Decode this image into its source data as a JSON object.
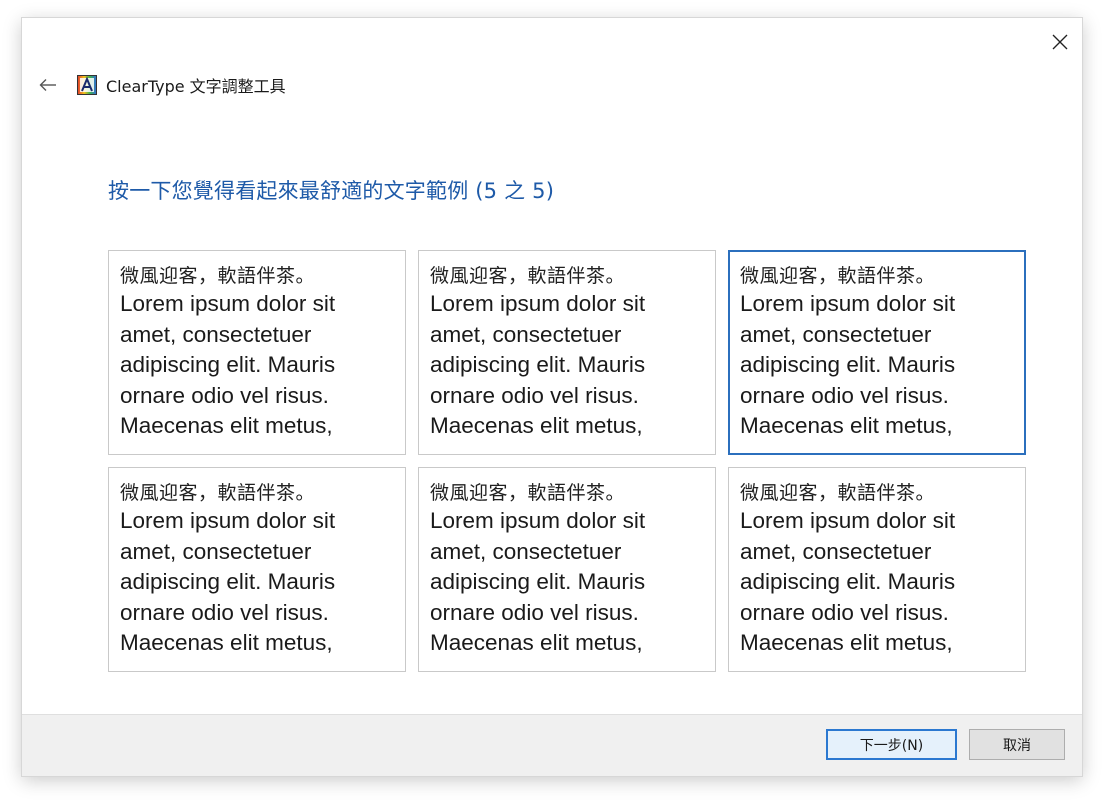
{
  "window": {
    "close_icon": "close-icon",
    "back_icon": "arrow-left-icon",
    "app_icon": "cleartype-icon",
    "app_title": "ClearType 文字調整工具"
  },
  "heading": "按一下您覺得看起來最舒適的文字範例 (5 之 5)",
  "samples": [
    {
      "cjk": "微風迎客，軟語伴茶。",
      "latin": "Lorem ipsum dolor sit amet, consectetuer adipiscing elit. Mauris ornare odio vel risus. Maecenas elit metus,",
      "selected": false
    },
    {
      "cjk": "微風迎客，軟語伴茶。",
      "latin": "Lorem ipsum dolor sit amet, consectetuer adipiscing elit. Mauris ornare odio vel risus. Maecenas elit metus,",
      "selected": false
    },
    {
      "cjk": "微風迎客，軟語伴茶。",
      "latin": "Lorem ipsum dolor sit amet, consectetuer adipiscing elit. Mauris ornare odio vel risus. Maecenas elit metus,",
      "selected": true
    },
    {
      "cjk": "微風迎客，軟語伴茶。",
      "latin": "Lorem ipsum dolor sit amet, consectetuer adipiscing elit. Mauris ornare odio vel risus. Maecenas elit metus,",
      "selected": false
    },
    {
      "cjk": "微風迎客，軟語伴茶。",
      "latin": "Lorem ipsum dolor sit amet, consectetuer adipiscing elit. Mauris ornare odio vel risus. Maecenas elit metus,",
      "selected": false
    },
    {
      "cjk": "微風迎客，軟語伴茶。",
      "latin": "Lorem ipsum dolor sit amet, consectetuer adipiscing elit. Mauris ornare odio vel risus. Maecenas elit metus,",
      "selected": false
    }
  ],
  "footer": {
    "next_label": "下一步(N)",
    "cancel_label": "取消"
  },
  "colors": {
    "accent": "#2b6fbd",
    "heading": "#1e5aa8",
    "footer_bg": "#f0f0f0"
  }
}
